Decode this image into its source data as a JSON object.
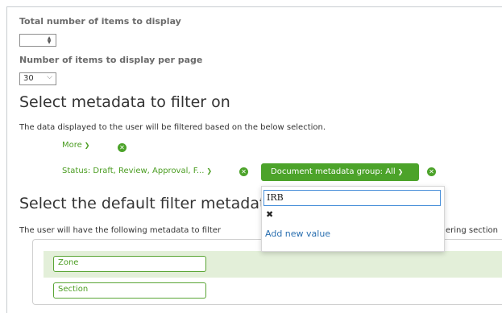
{
  "total_items": {
    "label": "Total number of items to display",
    "value": ""
  },
  "per_page": {
    "label": "Number of items to display per page",
    "value": "30"
  },
  "filter_section": {
    "heading": "Select metadata to filter on",
    "description": "The data displayed to the user will be filtered based on the below selection.",
    "more_label": "More",
    "status_filter_label": "Status: Draft, Review, Approval, F...",
    "group_filter_label": "Document metadata group: All"
  },
  "dropdown": {
    "input_value": "IRB",
    "clear_glyph": "✖",
    "add_new_label": "Add new value"
  },
  "default_section": {
    "heading": "Select the default filter metadata",
    "description": "The user will have the following metadata to filter",
    "description_tail": "ering section",
    "chips": [
      "Zone",
      "Section"
    ]
  },
  "colors": {
    "accent_green": "#4ca32a",
    "link_blue": "#2a6fb0",
    "row_highlight": "#e3efd9"
  }
}
